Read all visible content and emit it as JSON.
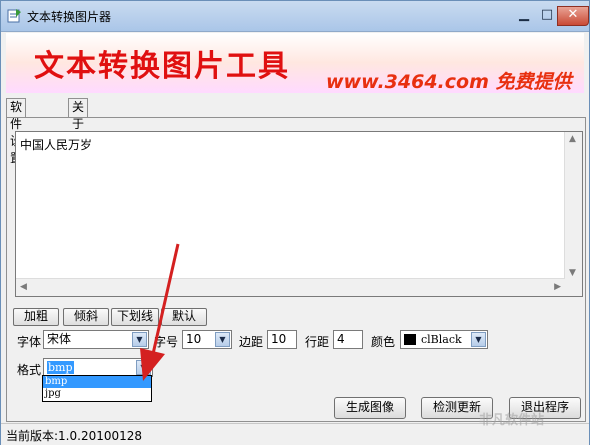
{
  "window": {
    "title": "文本转换图片器"
  },
  "banner": {
    "title": "文本转换图片工具",
    "subtitle": "www.3464.com 免费提供"
  },
  "tabs": [
    {
      "label": "软件设置",
      "active": true
    },
    {
      "label": "关于我们",
      "active": false
    }
  ],
  "editor": {
    "text": "中国人民万岁"
  },
  "style_buttons": {
    "bold": "加粗",
    "italic": "倾斜",
    "underline": "下划线",
    "default": "默认"
  },
  "settings": {
    "font_label": "字体",
    "font_value": "宋体",
    "size_label": "字号",
    "size_value": "10",
    "margin_label": "边距",
    "margin_value": "10",
    "line_spacing_label": "行距",
    "line_spacing_value": "4",
    "color_label": "颜色",
    "color_value": "clBlack",
    "color_hex": "#000000",
    "format_label": "格式",
    "format_value": "bmp",
    "format_options": [
      "bmp",
      "jpg"
    ]
  },
  "actions": {
    "generate": "生成图像",
    "check_update": "检测更新",
    "exit": "退出程序"
  },
  "status": {
    "version": "当前版本:1.0.20100128"
  },
  "watermark": {
    "text": "非凡软件站"
  },
  "colors": {
    "banner_text": "#e01010",
    "accent_arrow": "#d42020",
    "selection": "#3399ff"
  }
}
